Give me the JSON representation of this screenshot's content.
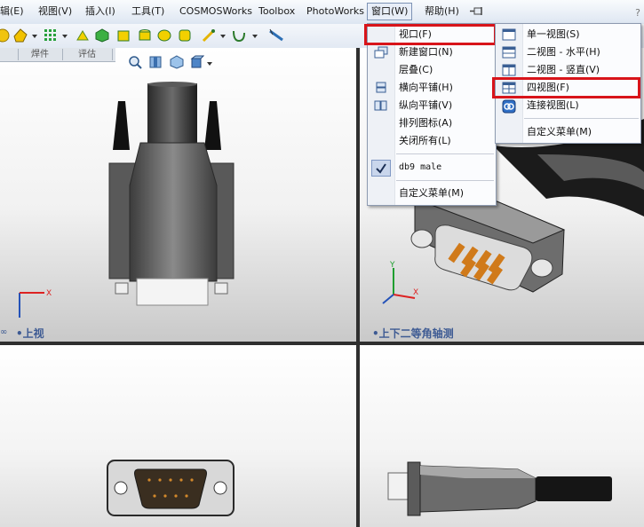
{
  "menubar": {
    "items": [
      {
        "label": "辑(E)"
      },
      {
        "label": "视图(V)"
      },
      {
        "label": "插入(I)"
      },
      {
        "label": "工具(T)"
      },
      {
        "label": "COSMOSWorks"
      },
      {
        "label": "Toolbox"
      },
      {
        "label": "PhotoWorks"
      },
      {
        "label": "窗口(W)"
      },
      {
        "label": "帮助(H)"
      }
    ],
    "help_mark": "?"
  },
  "tabs": [
    "焊件",
    "评估"
  ],
  "viewports": {
    "top_left_label": "上视",
    "top_right_label": "上下二等角轴测"
  },
  "window_menu": {
    "items": [
      {
        "label": "视口(F)",
        "icon": "viewport-icon"
      },
      {
        "label": "新建窗口(N)",
        "icon": "new-window-icon"
      },
      {
        "label": "层叠(C)",
        "icon": "cascade-icon"
      },
      {
        "label": "横向平铺(H)",
        "icon": "tile-horizontal-icon"
      },
      {
        "label": "纵向平铺(V)",
        "icon": "tile-vertical-icon"
      },
      {
        "label": "排列图标(A)",
        "icon": "arrange-icons-icon"
      },
      {
        "label": "关闭所有(L)",
        "icon": "close-all-icon"
      },
      {
        "label": "db9 male",
        "icon": "check-icon",
        "checked": true
      },
      {
        "label": "自定义菜单(M)",
        "icon": "customize-menu-icon"
      }
    ]
  },
  "viewport_submenu": {
    "items": [
      {
        "label": "单一视图(S)",
        "icon": "single-view-icon"
      },
      {
        "label": "二视图 - 水平(H)",
        "icon": "two-view-horizontal-icon"
      },
      {
        "label": "二视图 - 竖直(V)",
        "icon": "two-view-vertical-icon"
      },
      {
        "label": "四视图(F)",
        "icon": "four-view-icon"
      },
      {
        "label": "连接视图(L)",
        "icon": "link-views-icon"
      },
      {
        "label": "自定义菜单(M)",
        "icon": "customize-menu-icon"
      }
    ]
  },
  "colors": {
    "highlight_box": "#d8141a",
    "view_label": "#3d5a93",
    "divider": "#2f2f2f"
  }
}
